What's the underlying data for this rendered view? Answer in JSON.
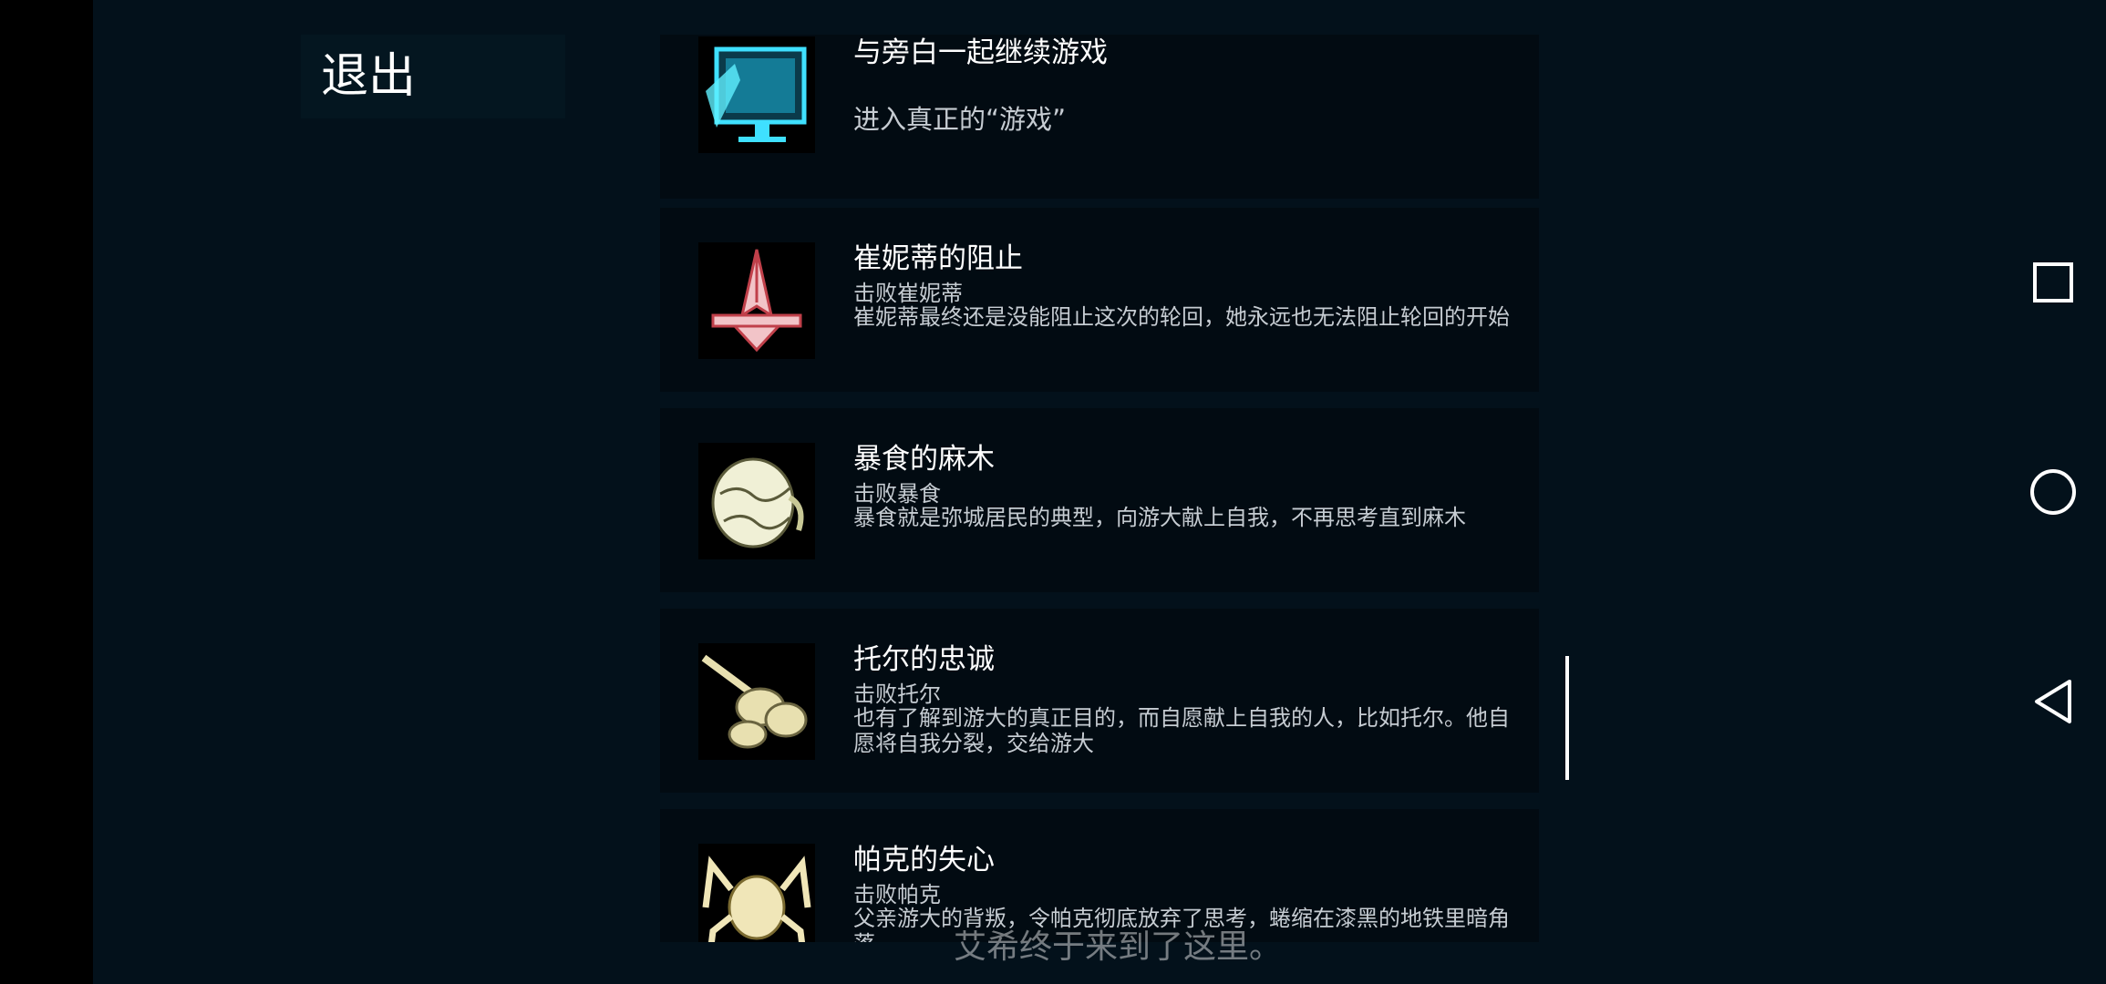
{
  "exit_label": "退出",
  "achievements": [
    {
      "title": "与旁白一起继续游戏",
      "condition": "进入真正的“游戏”",
      "description": "",
      "icon": "monitor-icon"
    },
    {
      "title": "崔妮蒂的阻止",
      "condition": "击败崔妮蒂",
      "description": "崔妮蒂最终还是没能阻止这次的轮回，她永远也无法阻止轮回的开始",
      "icon": "ship-icon"
    },
    {
      "title": "暴食的麻木",
      "condition": "击败暴食",
      "description": "暴食就是弥城居民的典型，向游大献上自我，不再思考直到麻木",
      "icon": "creature-icon"
    },
    {
      "title": "托尔的忠诚",
      "condition": "击败托尔",
      "description": "也有了解到游大的真正目的，而自愿献上自我的人，比如托尔。他自愿将自我分裂，交给游大",
      "icon": "tank-icon"
    },
    {
      "title": "帕克的失心",
      "condition": "击败帕克",
      "description": "父亲游大的背叛，令帕克彻底放弃了思考，蜷缩在漆黑的地铁里暗角落",
      "icon": "spider-icon"
    }
  ],
  "subtitle": "艾希终于来到了这里。",
  "nav": {
    "recents": "square-icon",
    "home": "circle-icon",
    "back": "triangle-icon"
  }
}
